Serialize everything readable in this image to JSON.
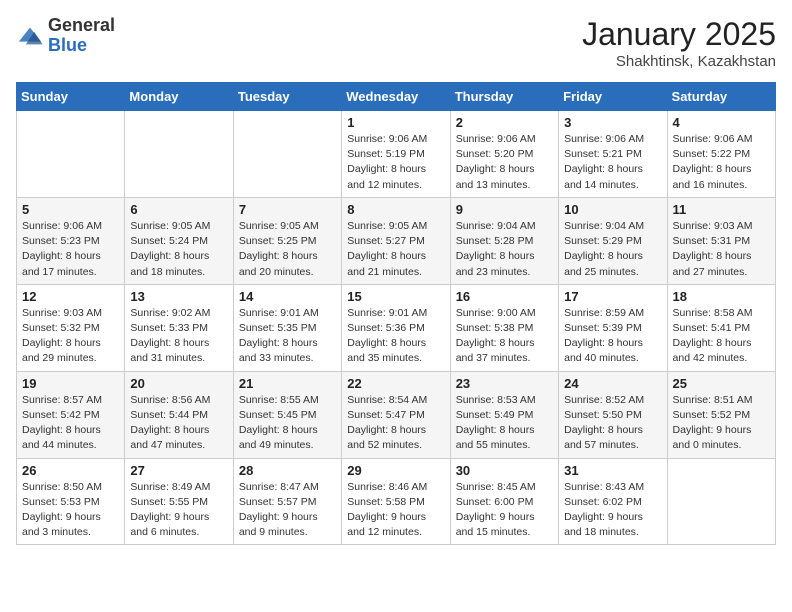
{
  "logo": {
    "general": "General",
    "blue": "Blue"
  },
  "title": "January 2025",
  "subtitle": "Shakhtinsk, Kazakhstan",
  "weekdays": [
    "Sunday",
    "Monday",
    "Tuesday",
    "Wednesday",
    "Thursday",
    "Friday",
    "Saturday"
  ],
  "weeks": [
    [
      null,
      null,
      null,
      {
        "day": "1",
        "sunrise": "9:06 AM",
        "sunset": "5:19 PM",
        "daylight": "8 hours and 12 minutes."
      },
      {
        "day": "2",
        "sunrise": "9:06 AM",
        "sunset": "5:20 PM",
        "daylight": "8 hours and 13 minutes."
      },
      {
        "day": "3",
        "sunrise": "9:06 AM",
        "sunset": "5:21 PM",
        "daylight": "8 hours and 14 minutes."
      },
      {
        "day": "4",
        "sunrise": "9:06 AM",
        "sunset": "5:22 PM",
        "daylight": "8 hours and 16 minutes."
      }
    ],
    [
      {
        "day": "5",
        "sunrise": "9:06 AM",
        "sunset": "5:23 PM",
        "daylight": "8 hours and 17 minutes."
      },
      {
        "day": "6",
        "sunrise": "9:05 AM",
        "sunset": "5:24 PM",
        "daylight": "8 hours and 18 minutes."
      },
      {
        "day": "7",
        "sunrise": "9:05 AM",
        "sunset": "5:25 PM",
        "daylight": "8 hours and 20 minutes."
      },
      {
        "day": "8",
        "sunrise": "9:05 AM",
        "sunset": "5:27 PM",
        "daylight": "8 hours and 21 minutes."
      },
      {
        "day": "9",
        "sunrise": "9:04 AM",
        "sunset": "5:28 PM",
        "daylight": "8 hours and 23 minutes."
      },
      {
        "day": "10",
        "sunrise": "9:04 AM",
        "sunset": "5:29 PM",
        "daylight": "8 hours and 25 minutes."
      },
      {
        "day": "11",
        "sunrise": "9:03 AM",
        "sunset": "5:31 PM",
        "daylight": "8 hours and 27 minutes."
      }
    ],
    [
      {
        "day": "12",
        "sunrise": "9:03 AM",
        "sunset": "5:32 PM",
        "daylight": "8 hours and 29 minutes."
      },
      {
        "day": "13",
        "sunrise": "9:02 AM",
        "sunset": "5:33 PM",
        "daylight": "8 hours and 31 minutes."
      },
      {
        "day": "14",
        "sunrise": "9:01 AM",
        "sunset": "5:35 PM",
        "daylight": "8 hours and 33 minutes."
      },
      {
        "day": "15",
        "sunrise": "9:01 AM",
        "sunset": "5:36 PM",
        "daylight": "8 hours and 35 minutes."
      },
      {
        "day": "16",
        "sunrise": "9:00 AM",
        "sunset": "5:38 PM",
        "daylight": "8 hours and 37 minutes."
      },
      {
        "day": "17",
        "sunrise": "8:59 AM",
        "sunset": "5:39 PM",
        "daylight": "8 hours and 40 minutes."
      },
      {
        "day": "18",
        "sunrise": "8:58 AM",
        "sunset": "5:41 PM",
        "daylight": "8 hours and 42 minutes."
      }
    ],
    [
      {
        "day": "19",
        "sunrise": "8:57 AM",
        "sunset": "5:42 PM",
        "daylight": "8 hours and 44 minutes."
      },
      {
        "day": "20",
        "sunrise": "8:56 AM",
        "sunset": "5:44 PM",
        "daylight": "8 hours and 47 minutes."
      },
      {
        "day": "21",
        "sunrise": "8:55 AM",
        "sunset": "5:45 PM",
        "daylight": "8 hours and 49 minutes."
      },
      {
        "day": "22",
        "sunrise": "8:54 AM",
        "sunset": "5:47 PM",
        "daylight": "8 hours and 52 minutes."
      },
      {
        "day": "23",
        "sunrise": "8:53 AM",
        "sunset": "5:49 PM",
        "daylight": "8 hours and 55 minutes."
      },
      {
        "day": "24",
        "sunrise": "8:52 AM",
        "sunset": "5:50 PM",
        "daylight": "8 hours and 57 minutes."
      },
      {
        "day": "25",
        "sunrise": "8:51 AM",
        "sunset": "5:52 PM",
        "daylight": "9 hours and 0 minutes."
      }
    ],
    [
      {
        "day": "26",
        "sunrise": "8:50 AM",
        "sunset": "5:53 PM",
        "daylight": "9 hours and 3 minutes."
      },
      {
        "day": "27",
        "sunrise": "8:49 AM",
        "sunset": "5:55 PM",
        "daylight": "9 hours and 6 minutes."
      },
      {
        "day": "28",
        "sunrise": "8:47 AM",
        "sunset": "5:57 PM",
        "daylight": "9 hours and 9 minutes."
      },
      {
        "day": "29",
        "sunrise": "8:46 AM",
        "sunset": "5:58 PM",
        "daylight": "9 hours and 12 minutes."
      },
      {
        "day": "30",
        "sunrise": "8:45 AM",
        "sunset": "6:00 PM",
        "daylight": "9 hours and 15 minutes."
      },
      {
        "day": "31",
        "sunrise": "8:43 AM",
        "sunset": "6:02 PM",
        "daylight": "9 hours and 18 minutes."
      },
      null
    ]
  ]
}
